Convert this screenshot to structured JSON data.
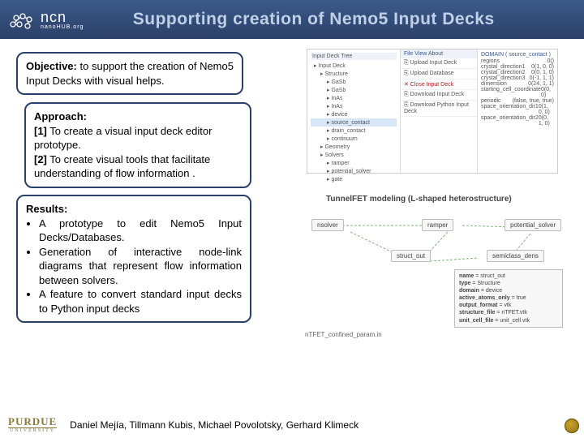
{
  "header": {
    "logo_main": "ncn",
    "logo_sub": "nanoHUB.org",
    "title": "Supporting creation of Nemo5 Input Decks"
  },
  "objective": {
    "label": "Objective:",
    "text": "to support the creation of Nemo5 Input Decks with visual helps."
  },
  "approach": {
    "label": "Approach:",
    "items": [
      {
        "n": "[1]",
        "text": "To create a visual input deck editor prototype."
      },
      {
        "n": "[2]",
        "text": "To create visual tools that facilitate understanding of flow information ."
      }
    ]
  },
  "results": {
    "label": "Results:",
    "bullets": [
      "A prototype to edit Nemo5 Input Decks/Databases.",
      "Generation of interactive node-link diagrams that represent flow information between solvers.",
      "A feature to convert standard input decks to Python input decks"
    ]
  },
  "editor_fig": {
    "tree_title": "Input Deck Tree",
    "tree": [
      {
        "d": 0,
        "label": "Input Deck"
      },
      {
        "d": 1,
        "label": "Structure"
      },
      {
        "d": 2,
        "label": "GaSb"
      },
      {
        "d": 2,
        "label": "GaSb"
      },
      {
        "d": 2,
        "label": "InAs"
      },
      {
        "d": 2,
        "label": "InAs"
      },
      {
        "d": 2,
        "label": "device"
      },
      {
        "d": 2,
        "label": "source_contact",
        "sel": true
      },
      {
        "d": 2,
        "label": "drain_contact"
      },
      {
        "d": 2,
        "label": "continuum"
      },
      {
        "d": 1,
        "label": "Geometry"
      },
      {
        "d": 1,
        "label": "Solvers"
      },
      {
        "d": 2,
        "label": "ramper"
      },
      {
        "d": 2,
        "label": "potential_solver"
      },
      {
        "d": 2,
        "label": "gate"
      }
    ],
    "tabs": "File   View   About",
    "menu": [
      {
        "label": "Upload Input Deck"
      },
      {
        "label": "Upload Database"
      },
      {
        "label": "Close Input Deck",
        "red": true
      },
      {
        "label": "Download Input Deck"
      },
      {
        "label": "Download Python Input Deck"
      }
    ],
    "props_header": "DOMAIN ( source_contact )",
    "props": [
      {
        "k": "regions",
        "v": "0()"
      },
      {
        "k": "crystal_direction1",
        "v": "0(1, 0, 0)"
      },
      {
        "k": "crystal_direction2",
        "v": "0(0, 1, 0)"
      },
      {
        "k": "crystal_direction3",
        "v": "0(-1, 1, 1)"
      },
      {
        "k": "dimension",
        "v": "0(24, 1, 1)"
      },
      {
        "k": "starting_cell_coordinate",
        "v": "0(0, 0)"
      },
      {
        "k": "periodic",
        "v": "(false, true, true)"
      },
      {
        "k": "space_orientation_dir1",
        "v": "0(1, 0, 0)"
      },
      {
        "k": "space_orientation_dir2",
        "v": "0(0, 1, 0)"
      }
    ]
  },
  "diagram_fig": {
    "title": "TunnelFET modeling (L-shaped heterostructure)",
    "nodes": {
      "nsolver": "nsolver",
      "ramper": "ramper",
      "potential_solver": "potential_solver",
      "struct_out": "struct_out",
      "semiclass_dens": "semiclass_dens"
    },
    "params": [
      "name = struct_out",
      "type = Structure",
      "domain = device",
      "active_atoms_only = true",
      "output_format = vtk",
      "structure_file = nTFET.vtk",
      "unit_cell_file = unit_cell.vtk"
    ],
    "caption": "nTFET_confined_param.in"
  },
  "footer": {
    "purdue_top": "PURDUE",
    "purdue_bottom": "UNIVERSITY",
    "authors": "Daniel Mejía, Tillmann Kubis, Michael Povolotsky, Gerhard Klimeck"
  }
}
